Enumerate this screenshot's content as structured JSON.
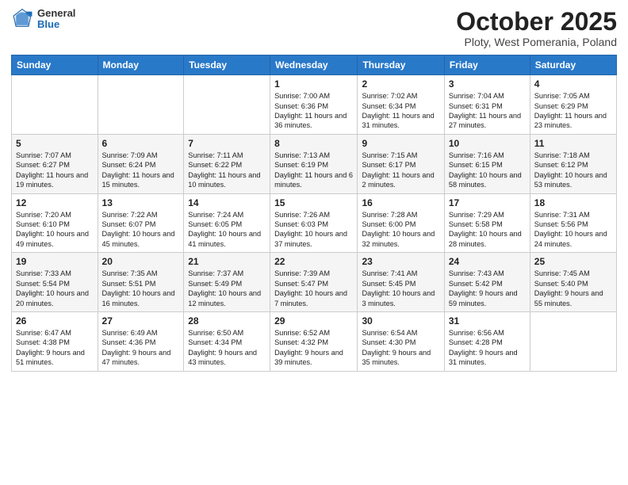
{
  "header": {
    "logo_general": "General",
    "logo_blue": "Blue",
    "title": "October 2025",
    "subtitle": "Ploty, West Pomerania, Poland"
  },
  "weekdays": [
    "Sunday",
    "Monday",
    "Tuesday",
    "Wednesday",
    "Thursday",
    "Friday",
    "Saturday"
  ],
  "rows": [
    [
      {
        "day": "",
        "info": ""
      },
      {
        "day": "",
        "info": ""
      },
      {
        "day": "",
        "info": ""
      },
      {
        "day": "1",
        "info": "Sunrise: 7:00 AM\nSunset: 6:36 PM\nDaylight: 11 hours\nand 36 minutes."
      },
      {
        "day": "2",
        "info": "Sunrise: 7:02 AM\nSunset: 6:34 PM\nDaylight: 11 hours\nand 31 minutes."
      },
      {
        "day": "3",
        "info": "Sunrise: 7:04 AM\nSunset: 6:31 PM\nDaylight: 11 hours\nand 27 minutes."
      },
      {
        "day": "4",
        "info": "Sunrise: 7:05 AM\nSunset: 6:29 PM\nDaylight: 11 hours\nand 23 minutes."
      }
    ],
    [
      {
        "day": "5",
        "info": "Sunrise: 7:07 AM\nSunset: 6:27 PM\nDaylight: 11 hours\nand 19 minutes."
      },
      {
        "day": "6",
        "info": "Sunrise: 7:09 AM\nSunset: 6:24 PM\nDaylight: 11 hours\nand 15 minutes."
      },
      {
        "day": "7",
        "info": "Sunrise: 7:11 AM\nSunset: 6:22 PM\nDaylight: 11 hours\nand 10 minutes."
      },
      {
        "day": "8",
        "info": "Sunrise: 7:13 AM\nSunset: 6:19 PM\nDaylight: 11 hours\nand 6 minutes."
      },
      {
        "day": "9",
        "info": "Sunrise: 7:15 AM\nSunset: 6:17 PM\nDaylight: 11 hours\nand 2 minutes."
      },
      {
        "day": "10",
        "info": "Sunrise: 7:16 AM\nSunset: 6:15 PM\nDaylight: 10 hours\nand 58 minutes."
      },
      {
        "day": "11",
        "info": "Sunrise: 7:18 AM\nSunset: 6:12 PM\nDaylight: 10 hours\nand 53 minutes."
      }
    ],
    [
      {
        "day": "12",
        "info": "Sunrise: 7:20 AM\nSunset: 6:10 PM\nDaylight: 10 hours\nand 49 minutes."
      },
      {
        "day": "13",
        "info": "Sunrise: 7:22 AM\nSunset: 6:07 PM\nDaylight: 10 hours\nand 45 minutes."
      },
      {
        "day": "14",
        "info": "Sunrise: 7:24 AM\nSunset: 6:05 PM\nDaylight: 10 hours\nand 41 minutes."
      },
      {
        "day": "15",
        "info": "Sunrise: 7:26 AM\nSunset: 6:03 PM\nDaylight: 10 hours\nand 37 minutes."
      },
      {
        "day": "16",
        "info": "Sunrise: 7:28 AM\nSunset: 6:00 PM\nDaylight: 10 hours\nand 32 minutes."
      },
      {
        "day": "17",
        "info": "Sunrise: 7:29 AM\nSunset: 5:58 PM\nDaylight: 10 hours\nand 28 minutes."
      },
      {
        "day": "18",
        "info": "Sunrise: 7:31 AM\nSunset: 5:56 PM\nDaylight: 10 hours\nand 24 minutes."
      }
    ],
    [
      {
        "day": "19",
        "info": "Sunrise: 7:33 AM\nSunset: 5:54 PM\nDaylight: 10 hours\nand 20 minutes."
      },
      {
        "day": "20",
        "info": "Sunrise: 7:35 AM\nSunset: 5:51 PM\nDaylight: 10 hours\nand 16 minutes."
      },
      {
        "day": "21",
        "info": "Sunrise: 7:37 AM\nSunset: 5:49 PM\nDaylight: 10 hours\nand 12 minutes."
      },
      {
        "day": "22",
        "info": "Sunrise: 7:39 AM\nSunset: 5:47 PM\nDaylight: 10 hours\nand 7 minutes."
      },
      {
        "day": "23",
        "info": "Sunrise: 7:41 AM\nSunset: 5:45 PM\nDaylight: 10 hours\nand 3 minutes."
      },
      {
        "day": "24",
        "info": "Sunrise: 7:43 AM\nSunset: 5:42 PM\nDaylight: 9 hours\nand 59 minutes."
      },
      {
        "day": "25",
        "info": "Sunrise: 7:45 AM\nSunset: 5:40 PM\nDaylight: 9 hours\nand 55 minutes."
      }
    ],
    [
      {
        "day": "26",
        "info": "Sunrise: 6:47 AM\nSunset: 4:38 PM\nDaylight: 9 hours\nand 51 minutes."
      },
      {
        "day": "27",
        "info": "Sunrise: 6:49 AM\nSunset: 4:36 PM\nDaylight: 9 hours\nand 47 minutes."
      },
      {
        "day": "28",
        "info": "Sunrise: 6:50 AM\nSunset: 4:34 PM\nDaylight: 9 hours\nand 43 minutes."
      },
      {
        "day": "29",
        "info": "Sunrise: 6:52 AM\nSunset: 4:32 PM\nDaylight: 9 hours\nand 39 minutes."
      },
      {
        "day": "30",
        "info": "Sunrise: 6:54 AM\nSunset: 4:30 PM\nDaylight: 9 hours\nand 35 minutes."
      },
      {
        "day": "31",
        "info": "Sunrise: 6:56 AM\nSunset: 4:28 PM\nDaylight: 9 hours\nand 31 minutes."
      },
      {
        "day": "",
        "info": ""
      }
    ]
  ]
}
